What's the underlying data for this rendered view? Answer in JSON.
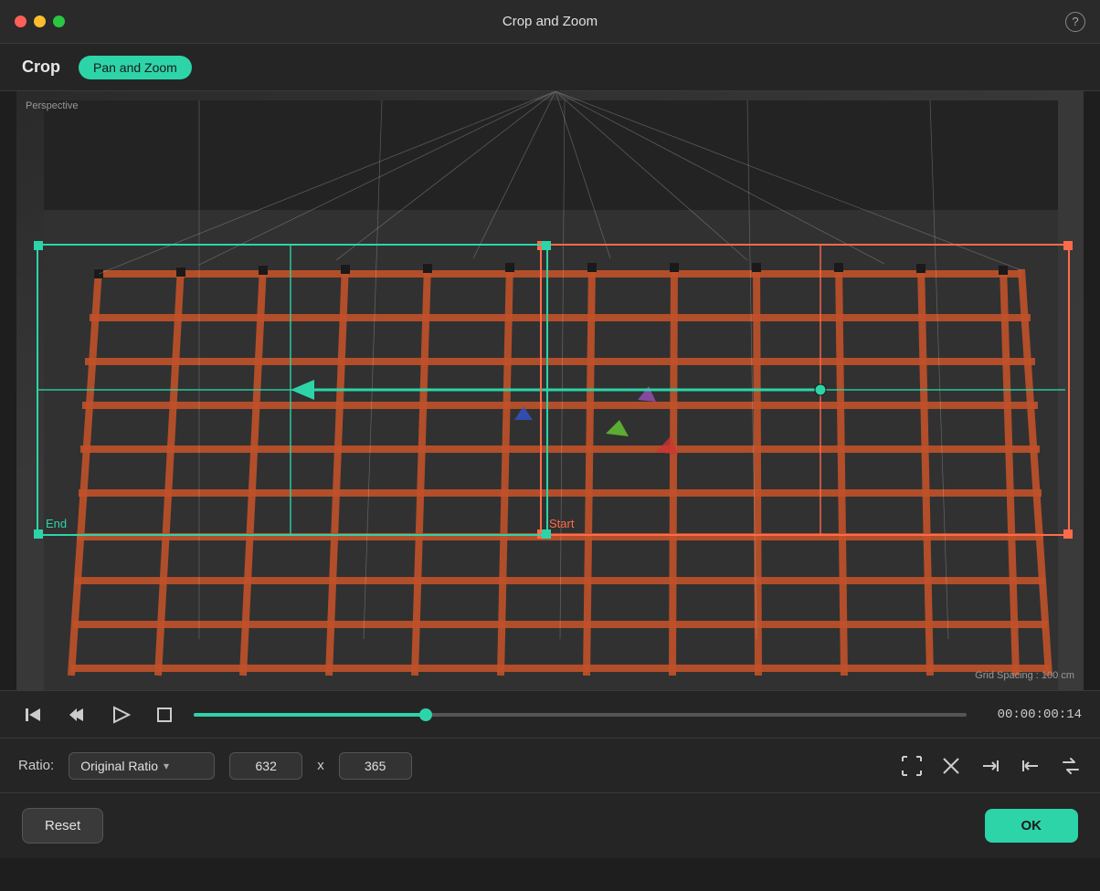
{
  "titlebar": {
    "title": "Crop and Zoom",
    "help": "?"
  },
  "tabs": {
    "crop_label": "Crop",
    "panzoom_label": "Pan and Zoom"
  },
  "viewport": {
    "perspective_label": "Perspective",
    "grid_spacing_label": "Grid Spacing : 100 cm",
    "start_label": "Start",
    "end_label": "End"
  },
  "timeline": {
    "time": "00:00:00:14",
    "slider_percent": 30
  },
  "ratio": {
    "label": "Ratio:",
    "ratio_text": "Original Ratio",
    "width": "632",
    "x_label": "x",
    "height": "365"
  },
  "icons": {
    "step_back": "⇤",
    "frame_back": "⊲",
    "play": "▷",
    "stop": "□"
  },
  "buttons": {
    "reset": "Reset",
    "ok": "OK"
  }
}
